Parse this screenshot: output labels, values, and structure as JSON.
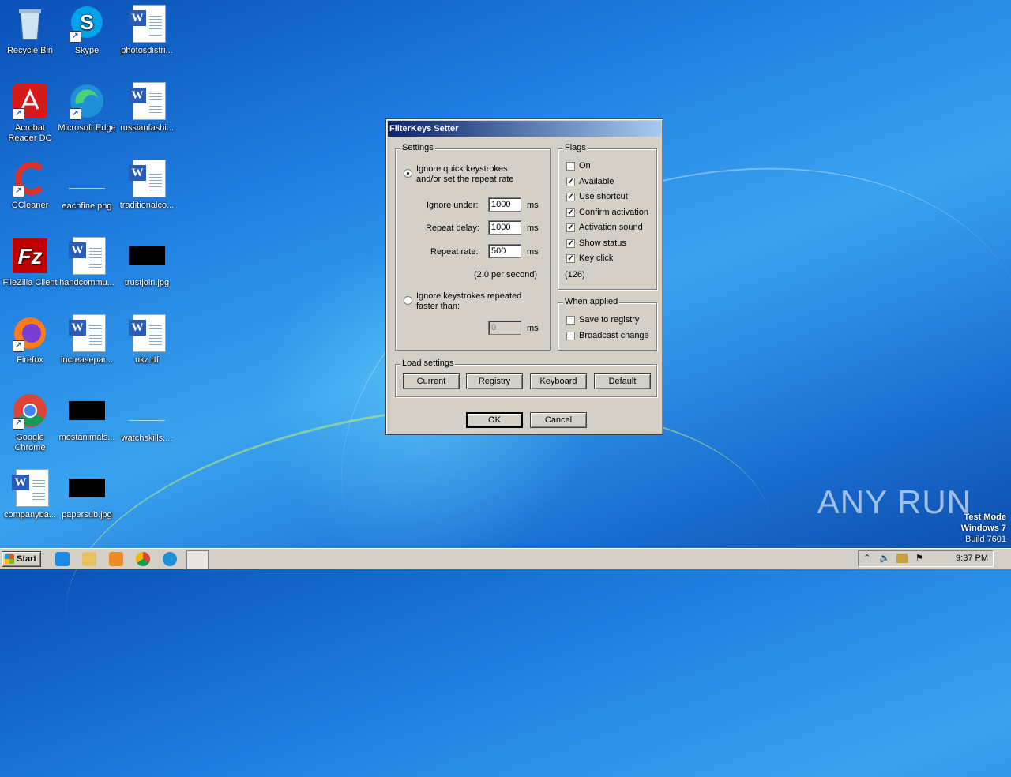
{
  "desktop": {
    "icons": [
      {
        "label": "Recycle Bin",
        "icon": "recycle-bin-icon"
      },
      {
        "label": "Skype",
        "icon": "skype-icon"
      },
      {
        "label": "photosdistri...",
        "icon": "word-document-icon"
      },
      {
        "label": "Acrobat Reader DC",
        "icon": "acrobat-icon"
      },
      {
        "label": "Microsoft Edge",
        "icon": "edge-icon"
      },
      {
        "label": "russianfashi...",
        "icon": "word-document-icon"
      },
      {
        "label": "CCleaner",
        "icon": "ccleaner-icon"
      },
      {
        "label": "eachfine.png",
        "icon": "image-file-icon"
      },
      {
        "label": "traditionalco...",
        "icon": "word-document-icon"
      },
      {
        "label": "FileZilla Client",
        "icon": "filezilla-icon"
      },
      {
        "label": "handcommu...",
        "icon": "word-document-icon"
      },
      {
        "label": "trustjoin.jpg",
        "icon": "image-file-icon"
      },
      {
        "label": "Firefox",
        "icon": "firefox-icon"
      },
      {
        "label": "increasepar...",
        "icon": "word-document-icon"
      },
      {
        "label": "ukz.rtf",
        "icon": "word-document-icon"
      },
      {
        "label": "Google Chrome",
        "icon": "chrome-icon"
      },
      {
        "label": "mostanimals...",
        "icon": "image-file-icon"
      },
      {
        "label": "watchskills....",
        "icon": "image-file-icon"
      },
      {
        "label": "companyba...",
        "icon": "word-document-icon"
      },
      {
        "label": "papersub.jpg",
        "icon": "image-file-icon"
      }
    ]
  },
  "dialog": {
    "title": "FilterKeys Setter",
    "settings": {
      "legend": "Settings",
      "option1_line1": "Ignore quick keystrokes",
      "option1_line2": "and/or set the repeat rate",
      "ignore_under_label": "Ignore under:",
      "ignore_under_value": "1000",
      "repeat_delay_label": "Repeat delay:",
      "repeat_delay_value": "1000",
      "repeat_rate_label": "Repeat rate:",
      "repeat_rate_value": "500",
      "unit": "ms",
      "per_second": "(2.0 per second)",
      "option2_line1": "Ignore keystrokes repeated",
      "option2_line2": "faster than:",
      "bounce_value": "0",
      "option1_selected": true
    },
    "flags": {
      "legend": "Flags",
      "items": [
        {
          "label": "On",
          "checked": false
        },
        {
          "label": "Available",
          "checked": true
        },
        {
          "label": "Use shortcut",
          "checked": true
        },
        {
          "label": "Confirm activation",
          "checked": true
        },
        {
          "label": "Activation sound",
          "checked": true
        },
        {
          "label": "Show status",
          "checked": true
        },
        {
          "label": "Key click",
          "checked": true
        }
      ],
      "value": "(126)"
    },
    "when_applied": {
      "legend": "When applied",
      "items": [
        {
          "label": "Save to registry",
          "checked": false
        },
        {
          "label": "Broadcast change",
          "checked": false
        }
      ]
    },
    "load_settings": {
      "legend": "Load settings",
      "buttons": [
        "Current",
        "Registry",
        "Keyboard",
        "Default"
      ]
    },
    "ok_label": "OK",
    "cancel_label": "Cancel"
  },
  "taskbar": {
    "start_label": "Start",
    "pinned": [
      "internet-explorer-icon",
      "file-explorer-icon",
      "media-player-icon",
      "chrome-icon",
      "edge-icon",
      "filterkeys-app-icon"
    ],
    "clock": "9:37 PM"
  },
  "watermark": "ANY RUN",
  "system_text": {
    "line1": "Test Mode",
    "line2": "Windows 7",
    "line3": "Build 7601"
  },
  "colors": {
    "titlebar_start": "#0a246a",
    "titlebar_end": "#a6caf0",
    "dialog_face": "#d4d0c8"
  }
}
